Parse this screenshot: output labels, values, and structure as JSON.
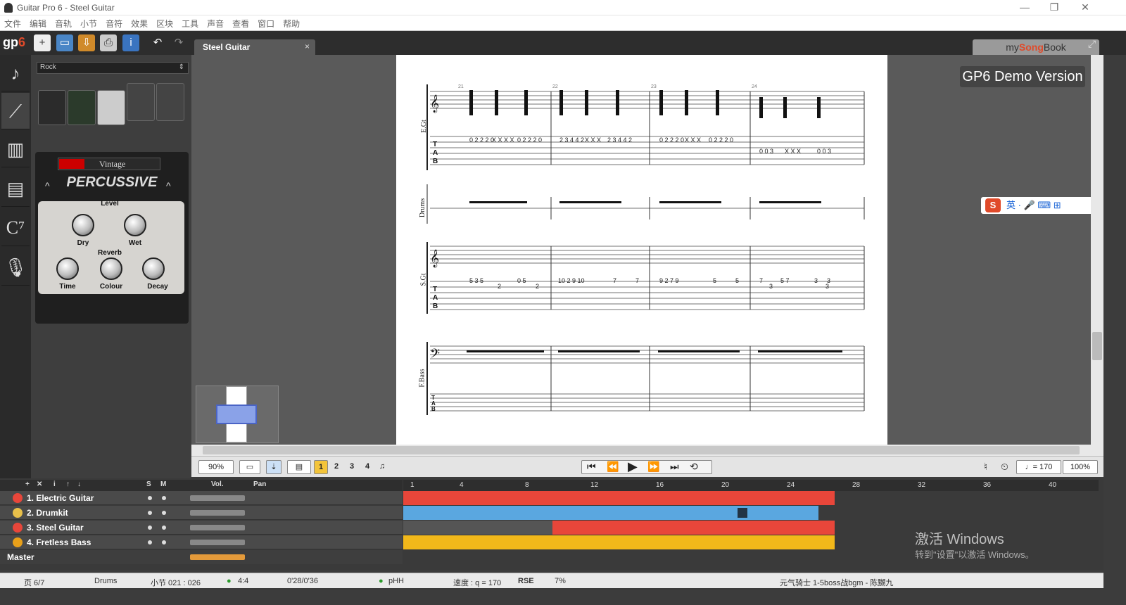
{
  "window": {
    "title": "Guitar Pro 6 - Steel Guitar",
    "minimize": "—",
    "restore": "❐",
    "close": "✕"
  },
  "menu": [
    "文件",
    "编辑",
    "音轨",
    "小节",
    "音符",
    "效果",
    "区块",
    "工具",
    "声音",
    "查看",
    "窗口",
    "帮助"
  ],
  "toolbar": {
    "logo_gp": "gp",
    "logo_six": "6",
    "tab_label": "Steel Guitar",
    "tab_close": "×",
    "mysongbook_my": "my",
    "mysongbook_song": "Song",
    "mysongbook_book": "Book"
  },
  "left_panel": {
    "preset": "Rock",
    "amp_preset": "Vintage",
    "effect_name": "PERCUSSIVE",
    "level_label": "Level",
    "reverb_label": "Reverb",
    "knobs": {
      "dry": "Dry",
      "wet": "Wet",
      "time": "Time",
      "colour": "Colour",
      "decay": "Decay"
    }
  },
  "score": {
    "demo_badge": "GP6 Demo Version",
    "track_labels": [
      "E.Gt",
      "Drums",
      "S.Gt",
      "F.Bass"
    ],
    "bar_numbers": [
      "21",
      "22",
      "23",
      "24"
    ],
    "sgt_tab_line1": [
      "5 3 5",
      "0 5",
      "10 2 9 10",
      "7",
      "7",
      "9 2 7 9",
      "5",
      "5",
      "7",
      "5 7",
      "3",
      "3"
    ],
    "sgt_tab_line2": [
      "2",
      "2",
      "3",
      "3"
    ]
  },
  "ime": {
    "logo": "S",
    "lang": "英"
  },
  "transport": {
    "zoom": "90%",
    "bars": [
      "1",
      "2",
      "3",
      "4"
    ],
    "tempo": "♩= 170",
    "speed": "100%"
  },
  "tracks_header": {
    "solo": "S",
    "mute": "M",
    "vol": "Vol.",
    "pan": "Pan"
  },
  "ruler": [
    "1",
    "4",
    "8",
    "12",
    "16",
    "20",
    "24",
    "28",
    "32",
    "36",
    "40"
  ],
  "tracks": [
    {
      "name": "1. Electric Guitar",
      "color": "#e8463a"
    },
    {
      "name": "2. Drumkit",
      "color": "#5aa7e0"
    },
    {
      "name": "3. Steel Guitar",
      "color": "#e8463a"
    },
    {
      "name": "4. Fretless Bass",
      "color": "#f2b81a"
    }
  ],
  "master": "Master",
  "watermark": {
    "line1": "激活 Windows",
    "line2": "转到\"设置\"以激活 Windows。"
  },
  "status": {
    "page": "页 6/7",
    "instrument": "Drums",
    "bar": "小节 021 : 026",
    "time_sig": "4:4",
    "time": "0'28/0'36",
    "key": "pHH",
    "tempo": "速度 : q = 170",
    "rse": "RSE",
    "cpu": "7%",
    "song": "元气骑士 1-5boss战bgm - 陈嬲九"
  }
}
